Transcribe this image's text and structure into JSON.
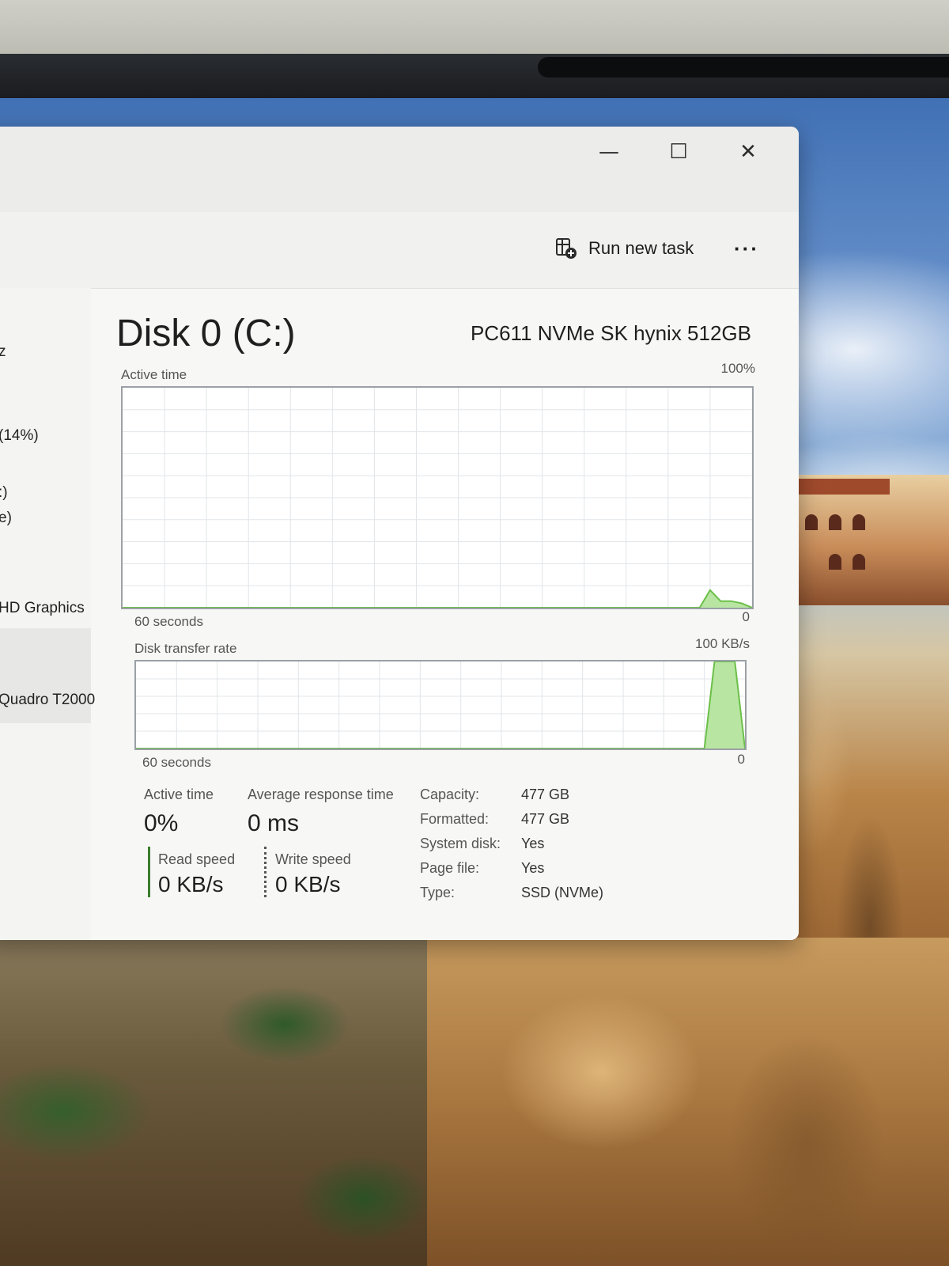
{
  "window": {
    "minimize_symbol": "—",
    "maximize_symbol": "☐",
    "close_symbol": "✕",
    "run_new_task": "Run new task",
    "more_symbol": "···"
  },
  "sidebar": {
    "items": [
      {
        "label": "z"
      },
      {
        "label": "(14%)"
      },
      {
        "label": ":)"
      },
      {
        "label": "e)"
      },
      {
        "label": "HD Graphics"
      },
      {
        "label": "Quadro T2000"
      }
    ]
  },
  "disk": {
    "title": "Disk 0 (C:)",
    "model": "PC611 NVMe SK hynix 512GB",
    "active_time_graph": {
      "label": "Active time",
      "max_label": "100%",
      "time_label": "60 seconds",
      "min_label": "0"
    },
    "transfer_graph": {
      "label": "Disk transfer rate",
      "max_label": "100 KB/s",
      "time_label": "60 seconds",
      "min_label": "0"
    },
    "stats": {
      "active_time_label": "Active time",
      "active_time_value": "0%",
      "avg_response_label": "Average response time",
      "avg_response_value": "0 ms",
      "read_speed_label": "Read speed",
      "read_speed_value": "0 KB/s",
      "write_speed_label": "Write speed",
      "write_speed_value": "0 KB/s"
    },
    "properties": [
      {
        "key": "Capacity:",
        "value": "477 GB"
      },
      {
        "key": "Formatted:",
        "value": "477 GB"
      },
      {
        "key": "System disk:",
        "value": "Yes"
      },
      {
        "key": "Page file:",
        "value": "Yes"
      },
      {
        "key": "Type:",
        "value": "SSD (NVMe)"
      }
    ]
  },
  "chart_data": [
    {
      "type": "area",
      "title": "Active time",
      "ylim": [
        0,
        100
      ],
      "x": [
        -60,
        -5,
        -4,
        -3,
        -2,
        -1,
        0
      ],
      "y": [
        0,
        0,
        8,
        3,
        3,
        2,
        0
      ],
      "grid": true
    },
    {
      "type": "area",
      "title": "Disk transfer rate",
      "ylim": [
        0,
        100
      ],
      "x": [
        -60,
        -4,
        -3,
        -2,
        -1,
        0
      ],
      "y": [
        0,
        0,
        100,
        100,
        100,
        0
      ],
      "grid": true
    }
  ],
  "colors": {
    "graph_line": "#6cbf4a",
    "graph_fill": "#b8e6a2",
    "graph_grid": "#e1e5e8",
    "graph_border": "#9aa0a6"
  }
}
